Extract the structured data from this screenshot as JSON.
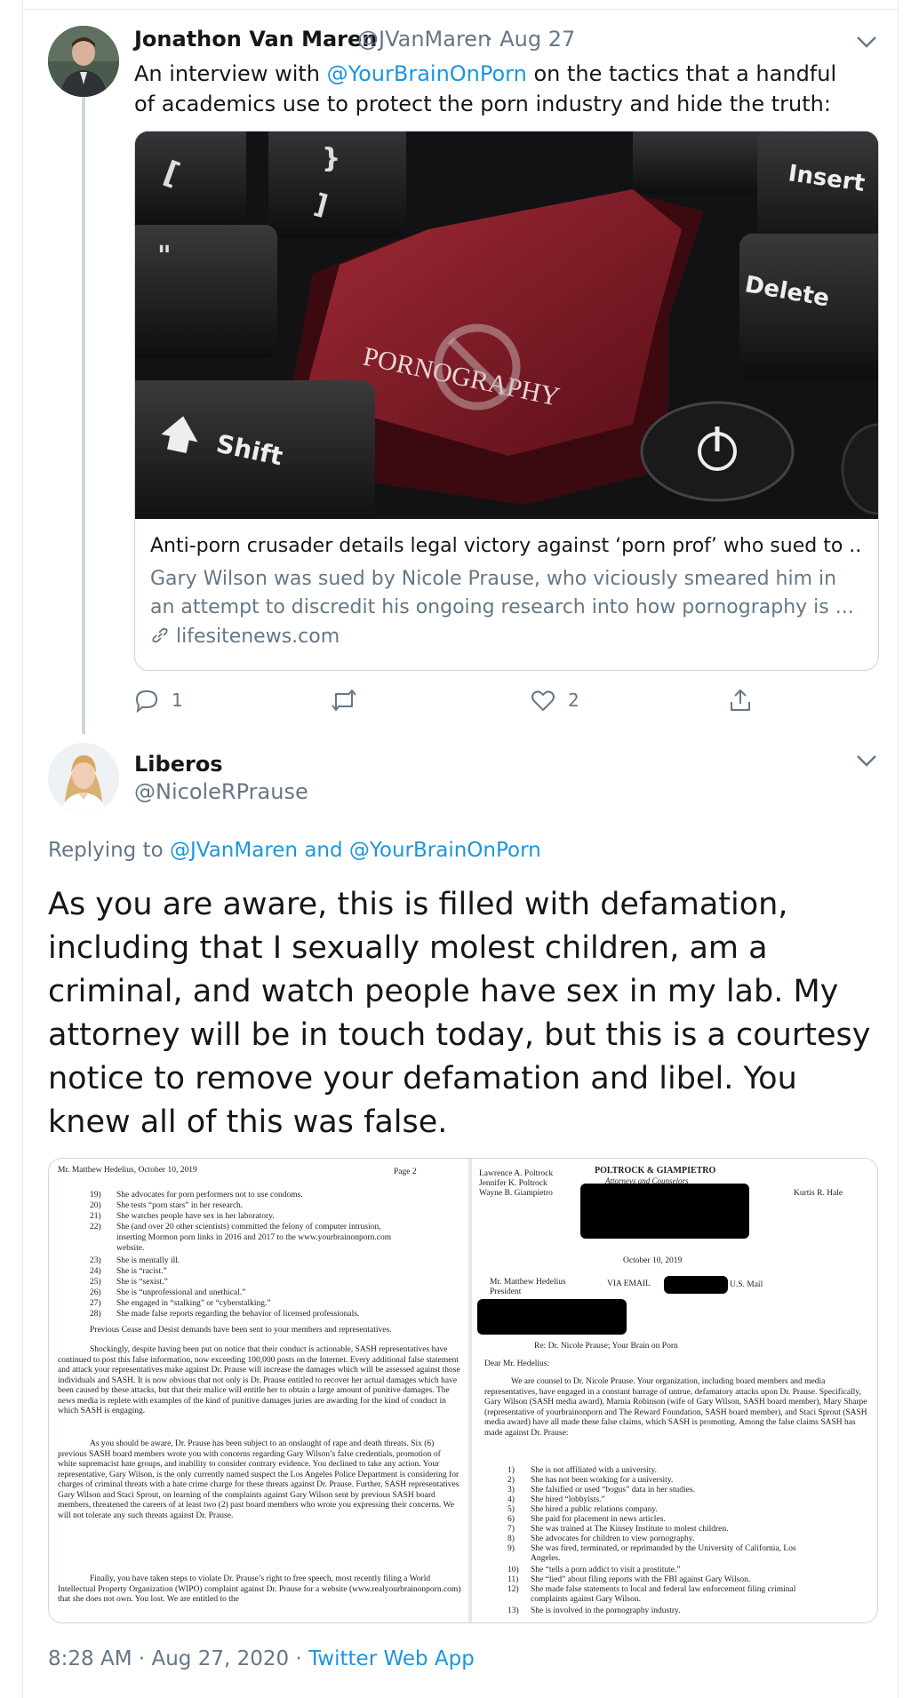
{
  "tweet1": {
    "name": "Jonathon Van Maren",
    "handle": "@JVanMaren",
    "date": "· Aug 27",
    "text_prefix": "An interview with ",
    "mention": "@YourBrainOnPorn",
    "text_suffix": " on the tactics that a handful of academics use to protect the porn industry and hide the truth:",
    "card": {
      "image_keys": {
        "insert": "Insert",
        "delete": "Delete",
        "shift": "Shift",
        "center": "PORNOGRAPHY"
      },
      "title": "Anti-porn crusader details legal victory against ‘porn prof’ who sued to ...",
      "description": "Gary Wilson was sued by Nicole Prause, who viciously smeared him in an attempt to discredit his ongoing research into how pornography is ...",
      "site": "lifesitenews.com"
    },
    "actions": {
      "reply_count": "1",
      "like_count": "2"
    }
  },
  "tweet2": {
    "name": "Liberos",
    "handle": "@NicoleRPrause",
    "replying_prefix": "Replying to ",
    "replying_to": "@JVanMaren and @YourBrainOnPorn",
    "text": "As you are aware, this is filled with defamation, including that I sexually molest children, am a criminal, and watch people have sex in my lab. My attorney will be in touch today, but this is a courtesy notice to remove your defamation and libel. You knew all of this was false.",
    "footer_time": "8:28 AM · Aug 27, 2020 · ",
    "footer_app": "Twitter Web App"
  },
  "letter": {
    "left": {
      "header": "Mr. Matthew Hedelius, October 10, 2019",
      "page": "Page 2",
      "items": [
        {
          "n": "19)",
          "t": "She advocates for porn performers not to use condoms."
        },
        {
          "n": "20)",
          "t": "She tests “porn stars” in her research."
        },
        {
          "n": "21)",
          "t": "She watches people have sex in her laboratory."
        },
        {
          "n": "22)",
          "t": "She (and over 20 other scientists) committed the felony of computer intrusion,"
        },
        {
          "n": "",
          "t": "inserting Mormon porn links in 2016 and 2017 to the www.yourbrainonporn.com"
        },
        {
          "n": "",
          "t": "website."
        },
        {
          "n": "23)",
          "t": "She is mentally ill."
        },
        {
          "n": "24)",
          "t": "She is “racist.”"
        },
        {
          "n": "25)",
          "t": "She is “sexist.”"
        },
        {
          "n": "26)",
          "t": "She is “unprofessional and unethical.”"
        },
        {
          "n": "27)",
          "t": "She engaged in “stalking” or “cyberstalking.”"
        },
        {
          "n": "28)",
          "t": "She made false reports regarding the behavior of licensed professionals."
        }
      ],
      "p1": "Previous Cease and Desist demands have been sent to your members and representatives.",
      "p2": "Shockingly, despite having been put on notice that their conduct is actionable, SASH representatives have continued to post this false information, now exceeding 100,000 posts on the Internet. Every additional false statement and attack your representatives make against Dr. Prause will increase the damages which will be assessed against those individuals and SASH. It is now obvious that not only is Dr. Prause entitled to recover her actual damages which have been caused by these attacks, but that their malice will entitle her to obtain a large amount of punitive damages. The news media is replete with examples of the kind of punitive damages juries are awarding for the kind of conduct in which SASH is engaging.",
      "p3": "As you should be aware, Dr. Prause has been subject to an onslaught of rape and death threats. Six (6) previous SASH board members wrote you with concerns regarding Gary Wilson’s false credentials, promotion of white supremacist hate groups, and inability to consider contrary evidence. You declined to take any action. Your representative, Gary Wilson, is the only currently named suspect the Los Angeles Police Department is considering for charges of criminal threats with a hate crime charge for these threats against Dr. Prause. Further, SASH representatives Gary Wilson and Staci Sprout, on learning of the complaints against Gary Wilson sent by previous SASH board members, threatened the careers of at least two (2) past board members who wrote you expressing their concerns. We will not tolerate any such threats against Dr. Prause.",
      "p4": "Finally, you have taken steps to violate Dr. Prause’s right to free speech, most recently filing a World Intellectual Property Organization (WIPO) complaint against Dr. Prause for a website (www.realyourbrainonporn.com) that she does not own. You lost. We are entitled to the"
    },
    "right": {
      "firm": "POLTROCK & GIAMPIETRO",
      "firm_sub": "Attorneys and Counselors",
      "names": [
        "Lawrence A. Poltrock",
        "Jennifer K. Poltrock",
        "Wayne B. Giampietro"
      ],
      "kurtis": "Kurtis R. Hale",
      "date": "October 10, 2019",
      "to_name": "Mr. Matthew Hedelius",
      "to_title": "President",
      "via": "VIA EMAIL",
      "mail": "U.S. Mail",
      "re": "Re: Dr. Nicole Prause; Your Brain on Porn",
      "salutation": "Dear Mr. Hedelius:",
      "body": "We are counsel to Dr. Nicole Prause. Your organization, including board members and media representatives, have engaged in a constant barrage of untrue, defamatory attacks upon Dr. Prause. Specifically, Gary Wilson (SASH media award), Marnia Robinson (wife of Gary Wilson, SASH board member), Mary Sharpe (representative of yourbrainonporn and The Reward Foundation, SASH board member), and Staci Sprout (SASH media award) have all made these false claims, which SASH is promoting. Among the false claims SASH has made against Dr. Prause:",
      "items": [
        {
          "n": "1)",
          "t": "She is not affiliated with a university."
        },
        {
          "n": "2)",
          "t": "She has not been working for a university."
        },
        {
          "n": "3)",
          "t": "She falsified or used “bogus” data in her studies."
        },
        {
          "n": "4)",
          "t": "She hired “lobbyists.”"
        },
        {
          "n": "5)",
          "t": "She hired a public relations company."
        },
        {
          "n": "6)",
          "t": "She paid for placement in news articles."
        },
        {
          "n": "7)",
          "t": "She was trained at The Kinsey Institute to molest children."
        },
        {
          "n": "8)",
          "t": "She advocates for children to view pornography."
        },
        {
          "n": "9)",
          "t": "She was fired, terminated, or reprimanded by the University of California, Los"
        },
        {
          "n": "",
          "t": "Angeles."
        },
        {
          "n": "10)",
          "t": "She “tells a porn addict to visit a prostitute.”"
        },
        {
          "n": "11)",
          "t": "She “lied” about filing reports with the FBI against Gary Wilson."
        },
        {
          "n": "12)",
          "t": "She made false statements to local and federal law enforcement filing criminal"
        },
        {
          "n": "",
          "t": "complaints against Gary Wilson."
        },
        {
          "n": "13)",
          "t": "She is involved in the pornography industry."
        }
      ]
    }
  },
  "icons": {
    "chevron": "chevron-down-icon",
    "reply": "reply-icon",
    "retweet": "retweet-icon",
    "like": "like-icon",
    "share": "share-icon",
    "link": "link-icon"
  },
  "colors": {
    "link_blue": "#1b95e0",
    "secondary_text": "#657786",
    "primary_text": "#14171a",
    "border": "#ccd6dd",
    "key_red": "#8b1d2a"
  }
}
